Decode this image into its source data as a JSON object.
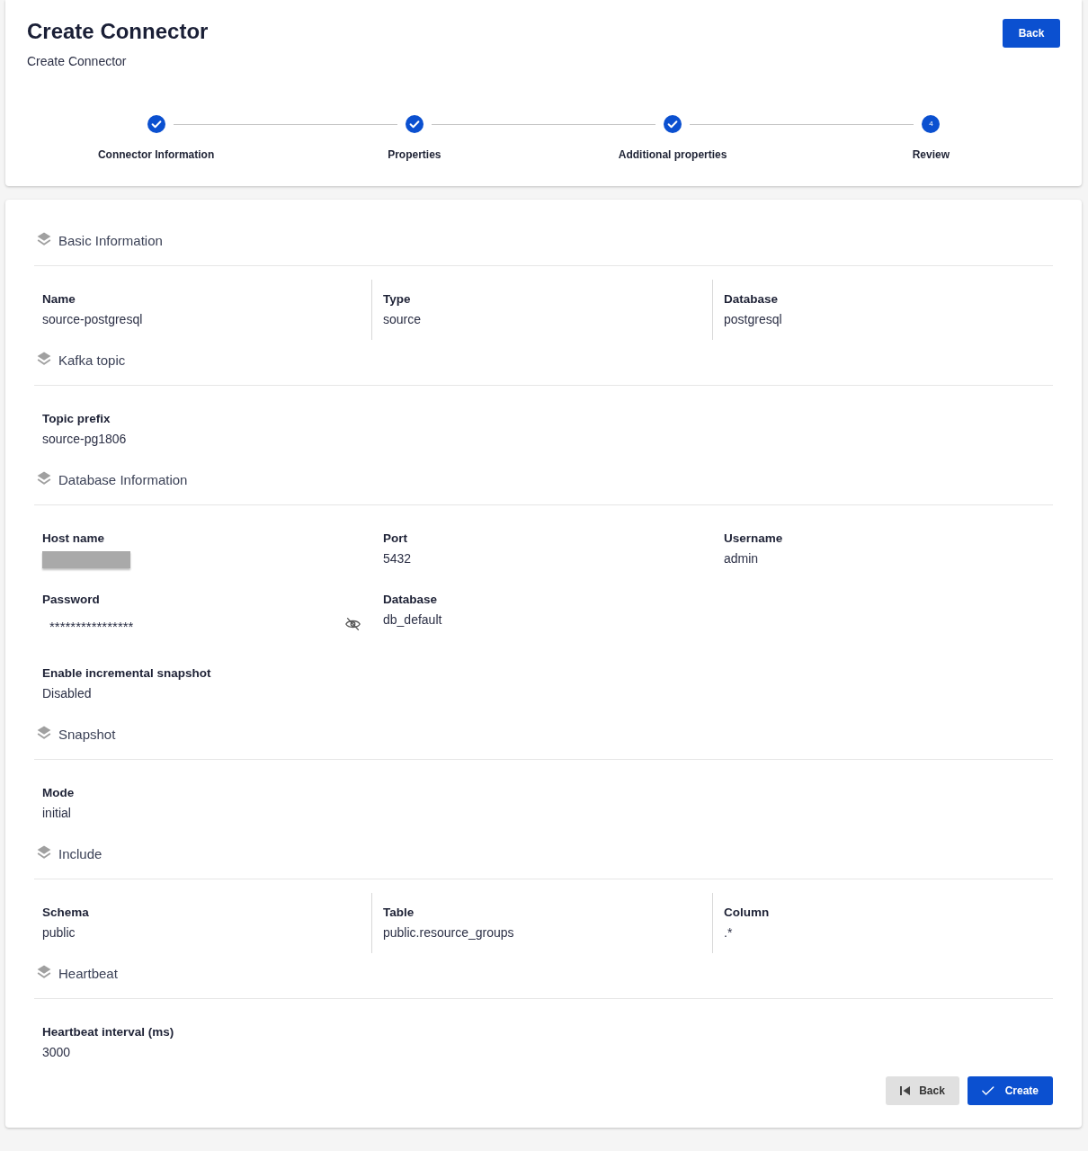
{
  "header": {
    "title": "Create Connector",
    "subtitle": "Create Connector",
    "back_button": "Back"
  },
  "stepper": {
    "steps": [
      {
        "label": "Connector Information",
        "completed": true
      },
      {
        "label": "Properties",
        "completed": true
      },
      {
        "label": "Additional properties",
        "completed": true
      },
      {
        "label": "Review",
        "completed": false,
        "number": "4"
      }
    ]
  },
  "sections": [
    {
      "title": "Basic Information",
      "separators": true,
      "rows": [
        [
          {
            "label": "Name",
            "kind": "text",
            "value": "source-postgresql"
          },
          {
            "label": "Type",
            "kind": "text",
            "value": "source"
          },
          {
            "label": "Database",
            "kind": "text",
            "value": "postgresql"
          }
        ]
      ]
    },
    {
      "title": "Kafka topic",
      "rows": [
        [
          {
            "label": "Topic prefix",
            "kind": "text",
            "value": "source-pg1806"
          }
        ]
      ]
    },
    {
      "title": "Database Information",
      "separators": false,
      "rows": [
        [
          {
            "label": "Host name",
            "kind": "redacted"
          },
          {
            "label": "Port",
            "kind": "text",
            "value": "5432"
          },
          {
            "label": "Username",
            "kind": "text",
            "value": "admin"
          }
        ],
        [
          {
            "label": "Password",
            "kind": "password",
            "value": "****************",
            "visible": false
          },
          {
            "label": "Database",
            "kind": "text",
            "value": "db_default"
          }
        ],
        [
          {
            "label": "Enable incremental snapshot",
            "kind": "text",
            "value": "Disabled"
          }
        ]
      ]
    },
    {
      "title": "Snapshot",
      "rows": [
        [
          {
            "label": "Mode",
            "kind": "text",
            "value": "initial"
          }
        ]
      ]
    },
    {
      "title": "Include",
      "separators": true,
      "rows": [
        [
          {
            "label": "Schema",
            "kind": "text",
            "value": "public"
          },
          {
            "label": "Table",
            "kind": "text",
            "value": "public.resource_groups"
          },
          {
            "label": "Column",
            "kind": "text",
            "value": ".*"
          }
        ]
      ]
    },
    {
      "title": "Heartbeat",
      "rows": [
        [
          {
            "label": "Heartbeat interval (ms)",
            "kind": "text",
            "value": "3000"
          }
        ]
      ]
    }
  ],
  "actions": {
    "back_button": "Back",
    "create_button": "Create"
  }
}
